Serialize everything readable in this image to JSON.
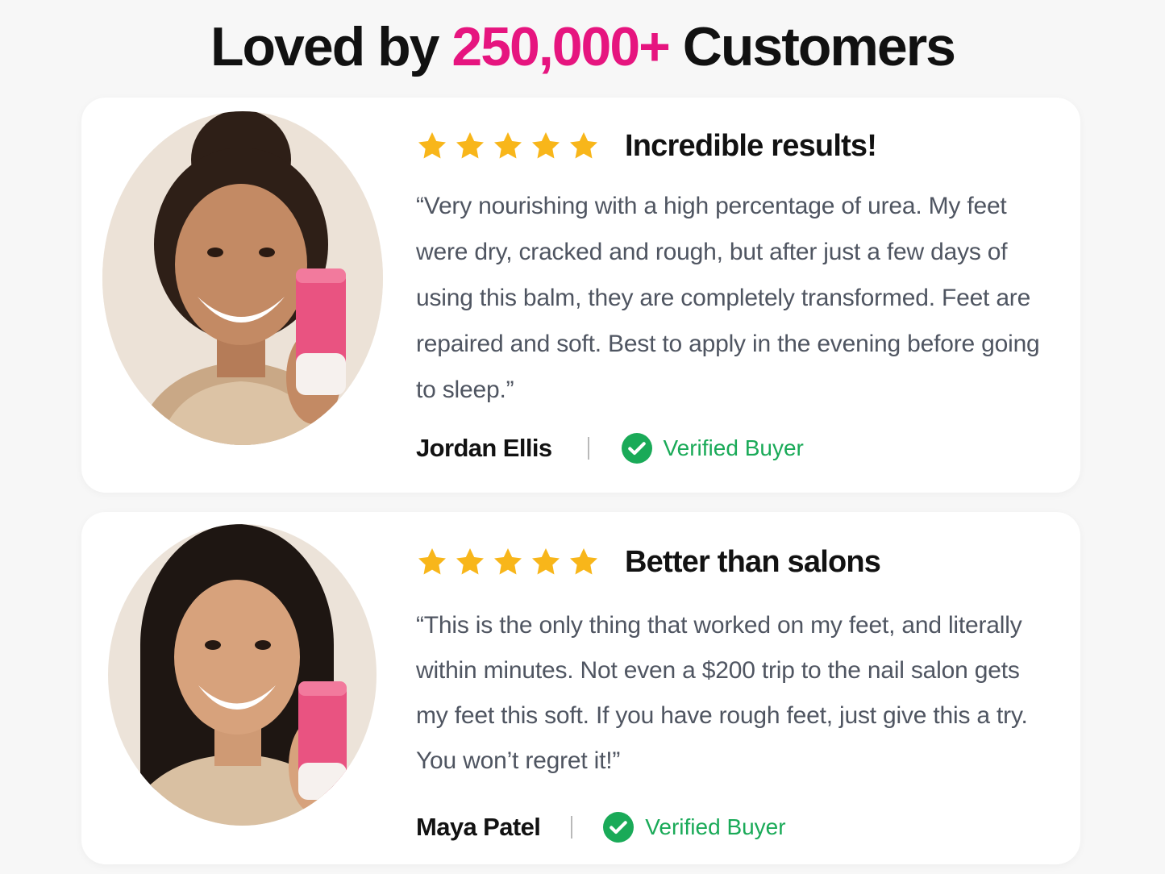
{
  "headline": {
    "prefix": "Loved by ",
    "highlight": "250,000+",
    "suffix": " Customers"
  },
  "colors": {
    "accent": "#e6157f",
    "star": "#f8b61a",
    "verified": "#1aaa58"
  },
  "reviews": [
    {
      "rating": 5,
      "title": "Incredible results!",
      "body": "“Very nourishing with a high percentage of urea. My feet were dry, cracked and rough, but after just a few days of using this balm, they are completely transformed. Feet are repaired and soft. Best to apply in the evening before going to sleep.”",
      "author": "Jordan Ellis",
      "badge": "Verified Buyer"
    },
    {
      "rating": 5,
      "title": "Better than salons",
      "body": "“This is the only thing that worked on my feet, and literally within minutes. Not even a $200 trip to the nail salon gets my feet this soft. If you have rough feet, just give this a try. You won’t regret it!”",
      "author": "Maya Patel",
      "badge": "Verified Buyer"
    }
  ]
}
